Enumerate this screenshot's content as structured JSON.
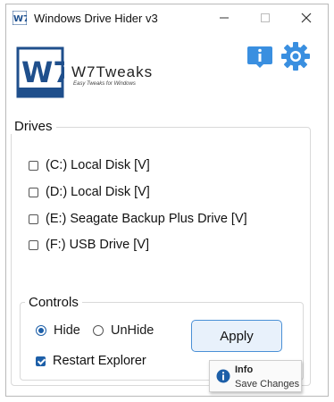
{
  "window": {
    "title": "Windows Drive Hider v3",
    "minimize_icon": "minimize-icon",
    "maximize_icon": "maximize-icon",
    "close_icon": "close-icon"
  },
  "logo": {
    "name": "W7Tweaks",
    "tagline": "Easy Tweaks for Windows",
    "mark": "W7"
  },
  "toolbar": {
    "info_icon": "info-icon",
    "settings_icon": "gear-icon"
  },
  "drives": {
    "title": "Drives",
    "items": [
      {
        "label": "(C:) Local Disk [V]",
        "checked": false
      },
      {
        "label": "(D:) Local Disk [V]",
        "checked": false
      },
      {
        "label": "(E:) Seagate Backup Plus Drive [V]",
        "checked": false
      },
      {
        "label": "(F:) USB Drive [V]",
        "checked": false
      }
    ]
  },
  "controls": {
    "title": "Controls",
    "hide_label": "Hide",
    "hide_selected": true,
    "unhide_label": "UnHide",
    "unhide_selected": false,
    "restart_label": "Restart Explorer",
    "restart_checked": true,
    "apply_label": "Apply"
  },
  "tooltip": {
    "title": "Info",
    "text": "Save Changes"
  },
  "colors": {
    "accent": "#1d5fa8",
    "button_border": "#4a90d6",
    "button_bg": "#e8f1fb",
    "icon_blue": "#3a8fe0"
  }
}
